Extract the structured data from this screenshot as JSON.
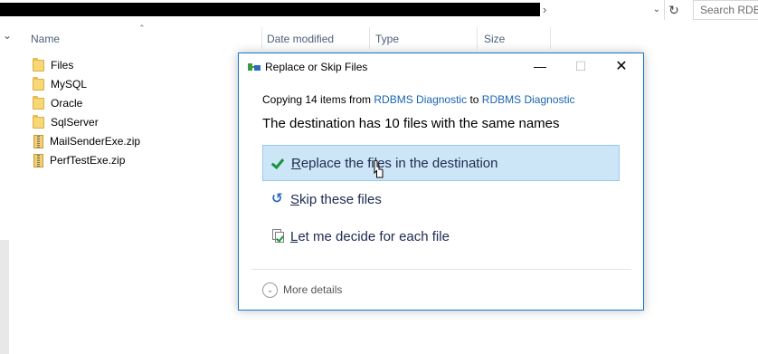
{
  "explorer": {
    "search_placeholder": "Search RDBMS",
    "columns": {
      "name": "Name",
      "date_modified": "Date modified",
      "type": "Type",
      "size": "Size"
    },
    "files": [
      {
        "name": "Files",
        "icon": "folder-icon"
      },
      {
        "name": "MySQL",
        "icon": "folder-icon"
      },
      {
        "name": "Oracle",
        "icon": "folder-icon"
      },
      {
        "name": "SqlServer",
        "icon": "folder-icon"
      },
      {
        "name": "MailSenderExe.zip",
        "icon": "zip-icon"
      },
      {
        "name": "PerfTestExe.zip",
        "icon": "zip-icon"
      }
    ]
  },
  "dialog": {
    "title": "Replace or Skip Files",
    "copy_prefix": "Copying 14 items from",
    "source": "RDBMS Diagnostic",
    "to_word": "to",
    "destination": "RDBMS Diagnostic",
    "message": "The destination has 10 files with the same names",
    "options": [
      {
        "label": "Replace the files in the destination",
        "icon": "check-icon",
        "selected": true
      },
      {
        "label": "Skip these files",
        "icon": "skip-icon",
        "selected": false
      },
      {
        "label": "Let me decide for each file",
        "icon": "decide-icon",
        "selected": false
      }
    ],
    "more_details": "More details"
  },
  "colors": {
    "accent_border": "#1979ca",
    "link": "#1a64b0",
    "selected_bg": "#cde6f7",
    "column_header": "#4c607a"
  }
}
